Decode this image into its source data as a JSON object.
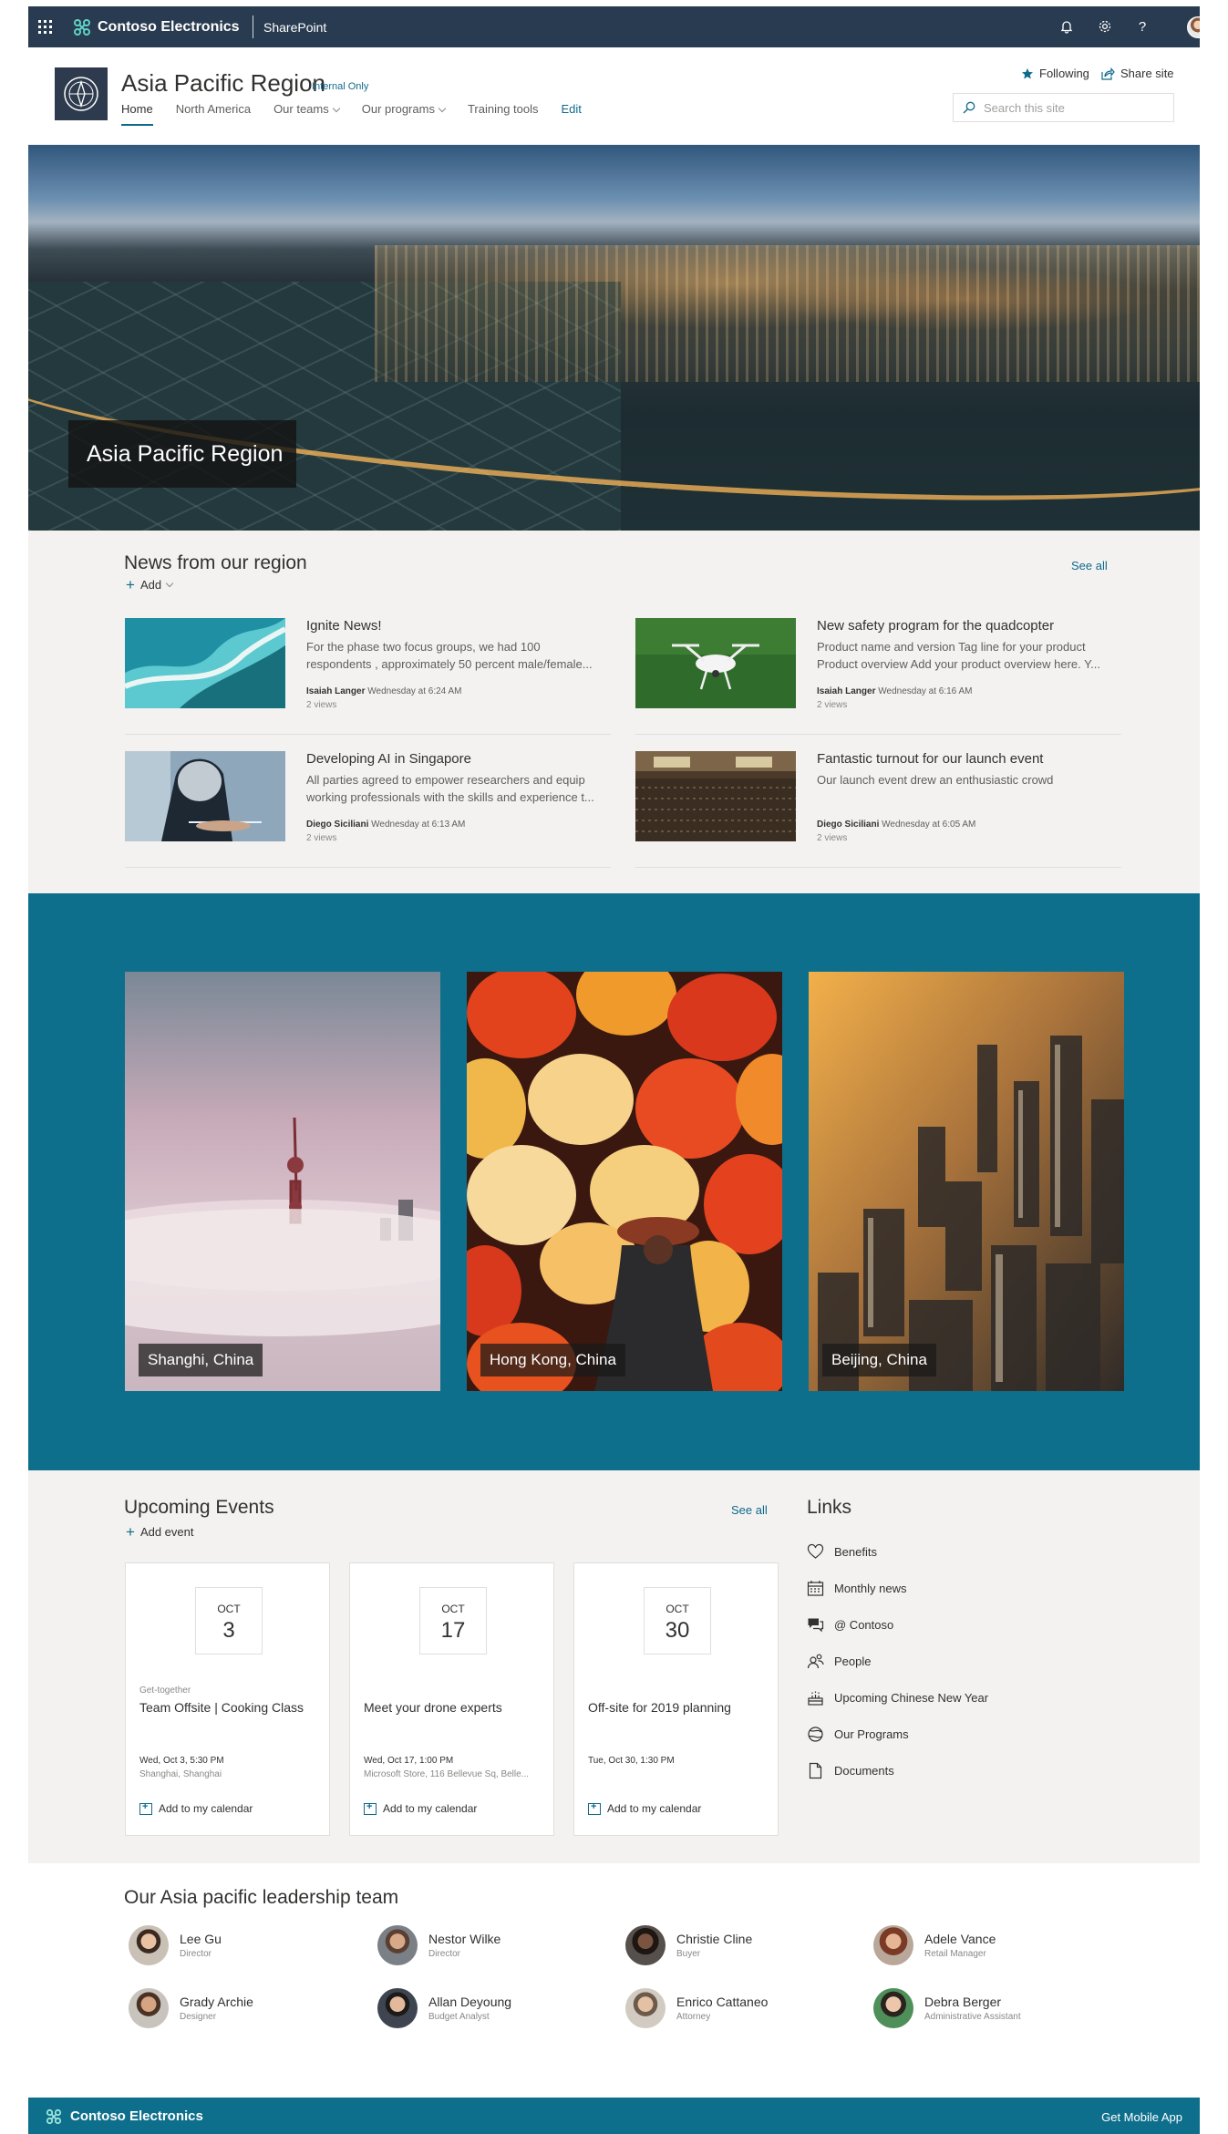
{
  "suite_bar": {
    "brand": "Contoso Electronics",
    "app": "SharePoint",
    "icons": [
      "waffle-icon",
      "bell-icon",
      "gear-icon",
      "help-icon"
    ]
  },
  "site": {
    "title": "Asia Pacific Region",
    "tag": "Internal Only",
    "nav": [
      {
        "label": "Home",
        "active": true
      },
      {
        "label": "North America"
      },
      {
        "label": "Our teams"
      },
      {
        "label": "Our programs"
      },
      {
        "label": "Training tools"
      },
      {
        "label": "Edit"
      }
    ],
    "following_label": "Following",
    "share_label": "Share site",
    "search_placeholder": "Search this site"
  },
  "hero": {
    "caption": "Asia Pacific Region"
  },
  "news": {
    "title": "News from our region",
    "see_all": "See all",
    "add_label": "Add",
    "items": [
      {
        "title": "Ignite News!",
        "desc": "For the phase two focus groups, we had 100 respondents , approximately 50 percent male/female...",
        "author": "Isaiah Langer",
        "date": "Wednesday at 6:24 AM",
        "views": "2 views"
      },
      {
        "title": "New safety program for the quadcopter",
        "desc": "Product name and version Tag line for your product Product overview Add your product overview here. Y...",
        "author": "Isaiah Langer",
        "date": "Wednesday at 6:16 AM",
        "views": "2 views"
      },
      {
        "title": "Developing AI in Singapore",
        "desc": "All parties agreed to empower researchers and equip working professionals with the skills and experience t...",
        "author": "Diego Siciliani",
        "date": "Wednesday at 6:13 AM",
        "views": "2 views"
      },
      {
        "title": "Fantastic turnout for our launch event",
        "desc": "Our launch event drew an enthusiastic crowd",
        "author": "Diego Siciliani",
        "date": "Wednesday at 6:05 AM",
        "views": "2 views"
      }
    ]
  },
  "cities": [
    {
      "label": "Shanghi, China"
    },
    {
      "label": "Hong Kong, China"
    },
    {
      "label": "Beijing, China"
    }
  ],
  "events": {
    "title": "Upcoming Events",
    "see_all": "See all",
    "add_label": "Add event",
    "items": [
      {
        "month": "OCT",
        "day": "3",
        "category": "Get-together",
        "title": "Team Offsite | Cooking Class",
        "when": "Wed, Oct 3, 5:30 PM",
        "where": "Shanghai, Shanghai",
        "add_cal": "Add to my calendar"
      },
      {
        "month": "OCT",
        "day": "17",
        "category": "",
        "title": "Meet your drone experts",
        "when": "Wed, Oct 17, 1:00 PM",
        "where": "Microsoft Store, 116 Bellevue Sq, Belle...",
        "add_cal": "Add to my calendar"
      },
      {
        "month": "OCT",
        "day": "30",
        "category": "",
        "title": "Off-site for 2019 planning",
        "when": "Tue, Oct 30, 1:30 PM",
        "where": "",
        "add_cal": "Add to my calendar"
      }
    ]
  },
  "links": {
    "title": "Links",
    "items": [
      {
        "label": "Benefits",
        "icon": "heart-icon"
      },
      {
        "label": "Monthly news",
        "icon": "calendar-icon"
      },
      {
        "label": "@ Contoso",
        "icon": "chat-icon"
      },
      {
        "label": "People",
        "icon": "people-icon"
      },
      {
        "label": "Upcoming Chinese New Year",
        "icon": "cake-icon"
      },
      {
        "label": "Our Programs",
        "icon": "globe-icon"
      },
      {
        "label": "Documents",
        "icon": "document-icon"
      }
    ]
  },
  "leadership": {
    "title": "Our Asia pacific leadership team",
    "people": [
      {
        "name": "Lee Gu",
        "role": "Director"
      },
      {
        "name": "Nestor Wilke",
        "role": "Director"
      },
      {
        "name": "Christie Cline",
        "role": "Buyer"
      },
      {
        "name": "Adele Vance",
        "role": "Retail Manager"
      },
      {
        "name": "Grady Archie",
        "role": "Designer"
      },
      {
        "name": "Allan Deyoung",
        "role": "Budget Analyst"
      },
      {
        "name": "Enrico Cattaneo",
        "role": "Attorney"
      },
      {
        "name": "Debra Berger",
        "role": "Administrative Assistant"
      }
    ]
  },
  "footer": {
    "brand": "Contoso Electronics",
    "mobile": "Get Mobile App"
  },
  "colors": {
    "suite_bar": "#293b50",
    "accent": "#0f6a8b",
    "band": "#0e6f8c",
    "section_bg": "#f3f2f1"
  }
}
